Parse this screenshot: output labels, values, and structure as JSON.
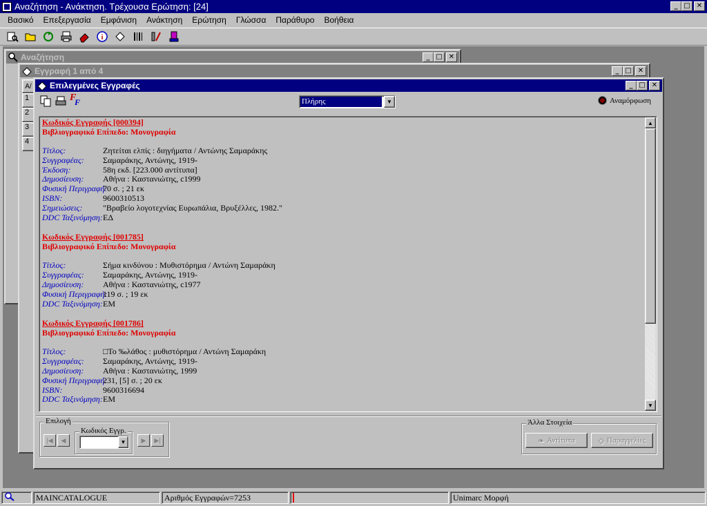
{
  "app": {
    "title": "Αναζήτηση - Ανάκτηση. Τρέχουσα Ερώτηση: [24]",
    "menu": [
      {
        "label": "Βασικό",
        "key": "a"
      },
      {
        "label": "Επεξεργασία",
        "key": "Ε"
      },
      {
        "label": "Εμφάνιση",
        "key": "φ"
      },
      {
        "label": "Ανάκτηση",
        "key": "ν"
      },
      {
        "label": "Ερώτηση",
        "key": "ρ"
      },
      {
        "label": "Γλώσσα",
        "key": "Γ"
      },
      {
        "label": "Παράθυρο",
        "key": "Π"
      },
      {
        "label": "Βοήθεια",
        "key": "Β"
      }
    ]
  },
  "windows": {
    "search": {
      "title": "Αναζήτηση"
    },
    "record": {
      "title": "Εγγραφή 1 από 4",
      "rows": [
        "1",
        "2",
        "3",
        "4"
      ],
      "col_header": "A/"
    },
    "selected": {
      "title": "Επιλεγμένες Εγγραφές",
      "format_select": "Πλήρης",
      "refresh_label": "Αναμόρφωση",
      "records": [
        {
          "code": "Κωδικός Εγγραφής [000394]",
          "level": "Βιβλιογραφικό Επίπεδο: Μονογραφία",
          "fields": [
            {
              "label": "Τίτλος:",
              "value": "Ζητείται ελπίς : διηγήματα / Αντώνης Σαμαράκης"
            },
            {
              "label": "Συγγραφέας:",
              "value": "Σαμαράκης, Αντώνης, 1919-"
            },
            {
              "label": "Έκδοση:",
              "value": "58η εκδ. [223.000 αντίτυπα]"
            },
            {
              "label": "Δημοσίευση:",
              "value": "Αθήνα : Καστανιώτης, c1999"
            },
            {
              "label": "Φυσική Περιγραφή:",
              "value": "70 σ. ; 21 εκ"
            },
            {
              "label": "ISBN:",
              "value": "9600310513"
            },
            {
              "label": "Σημειώσεις:",
              "value": "\"Βραβείο λογοτεχνίας Ευρωπάλια, Βρυξέλλες, 1982.\""
            },
            {
              "label": "DDC Ταξινόμηση:",
              "value": "ΕΔ"
            }
          ]
        },
        {
          "code": "Κωδικός Εγγραφής [001785]",
          "level": "Βιβλιογραφικό Επίπεδο: Μονογραφία",
          "fields": [
            {
              "label": "Τίτλος:",
              "value": "Σήμα κινδύνου : Μυθιστόρημα / Αντώνη Σαμαράκη"
            },
            {
              "label": "Συγγραφέας:",
              "value": "Σαμαράκης, Αντώνης, 1919-"
            },
            {
              "label": "Δημοσίευση:",
              "value": "Αθήνα : Καστανιώτης, c1977"
            },
            {
              "label": "Φυσική Περιγραφή:",
              "value": "119 σ. ; 19 εκ"
            },
            {
              "label": "DDC Ταξινόμηση:",
              "value": "ΕΜ"
            }
          ]
        },
        {
          "code": "Κωδικός Εγγραφής [001786]",
          "level": "Βιβλιογραφικό Επίπεδο: Μονογραφία",
          "fields": [
            {
              "label": "Τίτλος:",
              "value": "□Το ‰λάθος : μυθιστόρημα / Αντώνη Σαμαράκη"
            },
            {
              "label": "Συγγραφέας:",
              "value": "Σαμαράκης, Αντώνης, 1919-"
            },
            {
              "label": "Δημοσίευση:",
              "value": "Αθήνα : Καστανιώτης, 1999"
            },
            {
              "label": "Φυσική Περιγραφή:",
              "value": "231, [5] σ. ; 20 εκ"
            },
            {
              "label": "ISBN:",
              "value": "9600316694"
            },
            {
              "label": "DDC Ταξινόμηση:",
              "value": "ΕΜ"
            }
          ]
        }
      ],
      "selection_group": "Επιλογή",
      "code_group": "Κωδικός Εγγρ.",
      "other_group": "Άλλα Στοιχεία",
      "copies_button": "Αντίτυπα",
      "orders_button": "Παραγγελίες"
    }
  },
  "status": {
    "catalogue": "MAINCATALOGUE",
    "count": "Αριθμός Εγγραφών=7253",
    "format": "Unimarc Μορφή"
  },
  "colors": {
    "title_active": "#000080",
    "code_red": "#e00000",
    "label_blue": "#0000c0"
  }
}
